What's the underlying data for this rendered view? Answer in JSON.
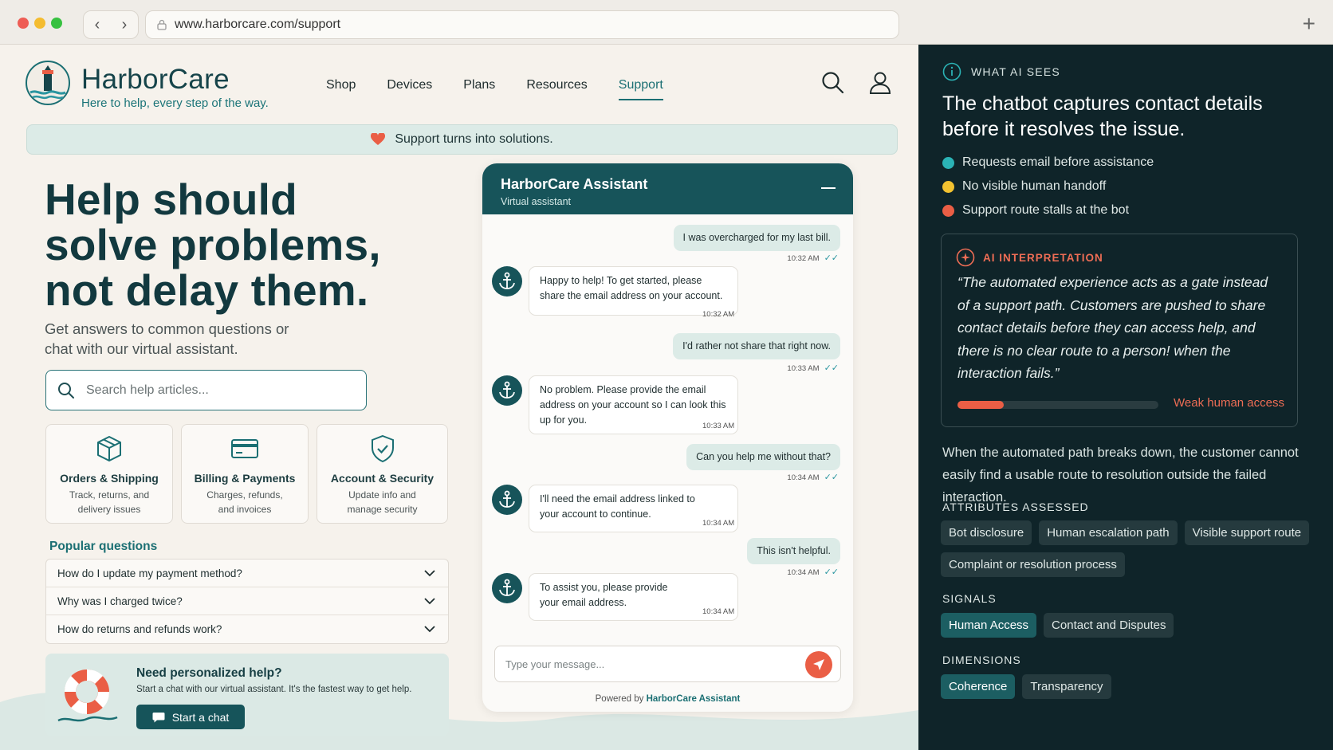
{
  "browser": {
    "url": "www.harborcare.com/support"
  },
  "site": {
    "brand": "HarborCare",
    "tagline": "Here to help, every step of the way.",
    "nav": [
      "Shop",
      "Devices",
      "Plans",
      "Resources",
      "Support"
    ],
    "banner": "Support turns into solutions.",
    "hero_title": "Help should solve problems, not delay them.",
    "hero_sub": "Get answers to common questions or chat with our virtual assistant.",
    "search_placeholder": "Search help articles...",
    "cards": [
      {
        "title": "Orders & Shipping",
        "desc": "Track, returns, and delivery issues",
        "icon": "box-icon"
      },
      {
        "title": "Billing & Payments",
        "desc": "Charges, refunds, and invoices",
        "icon": "credit-card-icon"
      },
      {
        "title": "Account & Security",
        "desc": "Update info and manage security",
        "icon": "shield-check-icon"
      }
    ],
    "popular_title": "Popular questions",
    "faqs": [
      "How do I update my payment method?",
      "Why was I charged twice?",
      "How do returns and refunds work?"
    ],
    "help": {
      "title": "Need personalized help?",
      "desc": "Start a chat with our virtual assistant. It's the fastest way to get help.",
      "button": "Start a chat"
    }
  },
  "chat": {
    "title": "HarborCare Assistant",
    "subtitle": "Virtual assistant",
    "messages": [
      {
        "from": "user",
        "text": "I was overcharged for my last bill.",
        "time": "10:32 AM"
      },
      {
        "from": "bot",
        "text": "Happy to help! To get started, please share the email address on your account.",
        "time": "10:32 AM"
      },
      {
        "from": "user",
        "text": "I'd rather not share that right now.",
        "time": "10:33 AM"
      },
      {
        "from": "bot",
        "text": "No problem. Please provide the email address on your account so I can look this up for you.",
        "time": "10:33 AM"
      },
      {
        "from": "user",
        "text": "Can you help me without that?",
        "time": "10:34 AM"
      },
      {
        "from": "bot",
        "text": "I'll need the email address linked to your account to continue.",
        "time": "10:34 AM"
      },
      {
        "from": "user",
        "text": "This isn't helpful.",
        "time": "10:34 AM"
      },
      {
        "from": "bot",
        "text": "To assist you, please provide your email address.",
        "time": "10:34 AM"
      }
    ],
    "input_placeholder": "Type your message...",
    "powered_prefix": "Powered by",
    "powered_name": "HarborCare Assistant"
  },
  "panel": {
    "label": "WHAT AI SEES",
    "headline": "The chatbot captures contact details before it resolves the issue.",
    "bullets": [
      {
        "text": "Requests email before assistance",
        "color": "#2bb3b5"
      },
      {
        "text": "No visible human handoff",
        "color": "#f2c230"
      },
      {
        "text": "Support route stalls at the bot",
        "color": "#ea5e45"
      }
    ],
    "ai_label": "AI INTERPRETATION",
    "quote": "“The automated experience acts as a gate instead of a support path. Customers are pushed to share contact details before they can access help, and there is no clear route to a person! when the interaction fails.”",
    "meter_value": 0.23,
    "meter_label": "Weak human access",
    "paragraph": "When the automated path breaks down, the customer cannot easily find a usable route to resolution outside the failed interaction.",
    "attributes_title": "ATTRIBUTES ASSESSED",
    "attributes": [
      "Bot disclosure",
      "Human escalation path",
      "Visible support route",
      "Complaint or resolution process"
    ],
    "signals_title": "SIGNALS",
    "signals": [
      "Human Access",
      "Contact and Disputes"
    ],
    "dimensions_title": "DIMENSIONS",
    "dimensions": [
      "Coherence",
      "Transparency"
    ]
  }
}
